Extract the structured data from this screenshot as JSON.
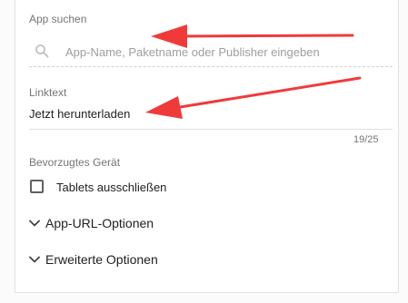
{
  "search": {
    "label": "App suchen",
    "placeholder": "App-Name, Paketname oder Publisher eingeben"
  },
  "link_text": {
    "label": "Linktext",
    "value": "Jetzt herunterladen",
    "counter": "19/25"
  },
  "preferred_device": {
    "label": "Bevorzugtes Gerät",
    "checkbox_label": "Tablets ausschließen",
    "checked": false
  },
  "sections": {
    "app_url_options": "App-URL-Optionen",
    "advanced_options": "Erweiterte Optionen"
  },
  "colors": {
    "annotation_arrow": "#f03a3a"
  }
}
